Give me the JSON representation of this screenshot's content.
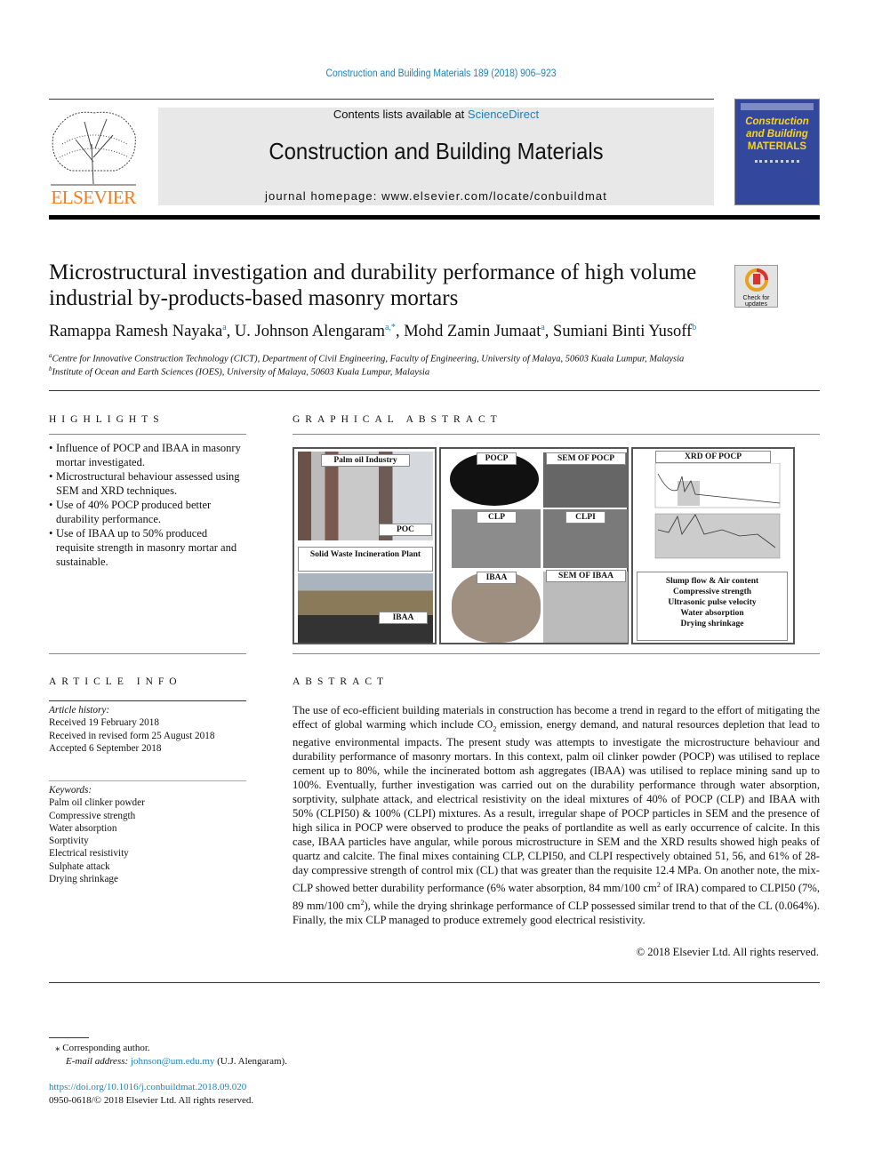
{
  "header": {
    "citation": "Construction and Building Materials 189 (2018) 906–923",
    "contents_prefix": "Contents lists available at ",
    "contents_link": "ScienceDirect",
    "journal_title": "Construction and Building Materials",
    "homepage": "journal homepage: www.elsevier.com/locate/conbuildmat",
    "publisher_logo": "ELSEVIER",
    "cover_lines": [
      "Construction",
      "and Building",
      "MATERIALS"
    ],
    "check_updates": "Check for updates"
  },
  "article": {
    "title": "Microstructural investigation and durability performance of high volume industrial by-products-based masonry mortars",
    "authors": [
      {
        "name": "Ramappa Ramesh Nayaka",
        "sup": "a"
      },
      {
        "name": "U. Johnson Alengaram",
        "sup": "a,*"
      },
      {
        "name": "Mohd Zamin Jumaat",
        "sup": "a"
      },
      {
        "name": "Sumiani Binti Yusoff",
        "sup": "b"
      }
    ],
    "affiliations": [
      {
        "sup": "a",
        "text": "Centre for Innovative Construction Technology (CICT), Department of Civil Engineering, Faculty of Engineering, University of Malaya, 50603 Kuala Lumpur, Malaysia"
      },
      {
        "sup": "b",
        "text": "Institute of Ocean and Earth Sciences (IOES), University of Malaya, 50603 Kuala Lumpur, Malaysia"
      }
    ]
  },
  "highlights": {
    "heading": "HIGHLIGHTS",
    "items": [
      "Influence of POCP and IBAA in masonry mortar investigated.",
      "Microstructural behaviour assessed using SEM and XRD techniques.",
      "Use of 40% POCP produced better durability performance.",
      "Use of IBAA up to 50% produced requisite strength in masonry mortar and sustainable."
    ]
  },
  "graphical_abstract": {
    "heading": "GRAPHICAL ABSTRACT",
    "labels": {
      "palm": "Palm oil Industry",
      "poc": "POC",
      "swip": "Solid Waste Incineration Plant",
      "ibaa_plant": "IBAA",
      "pocp": "POCP",
      "sem_pocp": "SEM OF POCP",
      "clp": "CLP",
      "clpi": "CLPI",
      "ibaa": "IBAA",
      "sem_ibaa": "SEM OF IBAA",
      "xrd": "XRD OF POCP"
    },
    "tests": [
      "Slump flow & Air content",
      "Compressive strength",
      "Ultrasonic pulse velocity",
      "Water absorption",
      "Drying shrinkage"
    ]
  },
  "article_info": {
    "heading": "ARTICLE INFO",
    "history_label": "Article history:",
    "history": [
      "Received 19 February 2018",
      "Received in revised form 25 August 2018",
      "Accepted 6 September 2018"
    ],
    "keywords_label": "Keywords:",
    "keywords": [
      "Palm oil clinker powder",
      "Compressive strength",
      "Water absorption",
      "Sorptivity",
      "Electrical resistivity",
      "Sulphate attack",
      "Drying shrinkage"
    ]
  },
  "abstract": {
    "heading": "ABSTRACT",
    "p1": "The use of eco-efficient building materials in construction has become a trend in regard to the effort of mitigating the effect of global warming which include CO",
    "p2": " emission, energy demand, and natural resources depletion that lead to negative environmental impacts. The present study was attempts to investigate the microstructure behaviour and durability performance of masonry mortars. In this context, palm oil clinker powder (POCP) was utilised to replace cement up to 80%, while the incinerated bottom ash aggregates (IBAA) was utilised to replace mining sand up to 100%. Eventually, further investigation was carried out on the durability performance through water absorption, sorptivity, sulphate attack, and electrical resistivity on the ideal mixtures of 40% of POCP (CLP) and IBAA with 50% (CLPI50) & 100% (CLPI) mixtures. As a result, irregular shape of POCP particles in SEM and the presence of high silica in POCP were observed to produce the peaks of portlandite as well as early occurrence of calcite. In this case, IBAA particles have angular, while porous microstructure in SEM and the XRD results showed high peaks of quartz and calcite. The final mixes containing CLP, CLPI50, and CLPI respectively obtained 51, 56, and 61% of 28-day compressive strength of control mix (CL) that was greater than the requisite 12.4 MPa. On another note, the mix- CLP showed better durability performance (6% water absorption, 84 mm/100 cm",
    "p3": " of IRA) compared to CLPI50 (7%, 89 mm/100 cm",
    "p4": "), while the drying shrinkage performance of CLP possessed similar trend to that of the CL (0.064%). Finally, the mix CLP managed to produce extremely good electrical resistivity.",
    "sub2": "2",
    "sup2": "2",
    "copyright": "© 2018 Elsevier Ltd. All rights reserved."
  },
  "footer": {
    "corresponding": "⁎ Corresponding author.",
    "email_label": "E-mail address: ",
    "email": "johnson@um.edu.my",
    "email_suffix": " (U.J. Alengaram).",
    "doi": "https://doi.org/10.1016/j.conbuildmat.2018.09.020",
    "issn": "0950-0618/© 2018 Elsevier Ltd. All rights reserved."
  }
}
